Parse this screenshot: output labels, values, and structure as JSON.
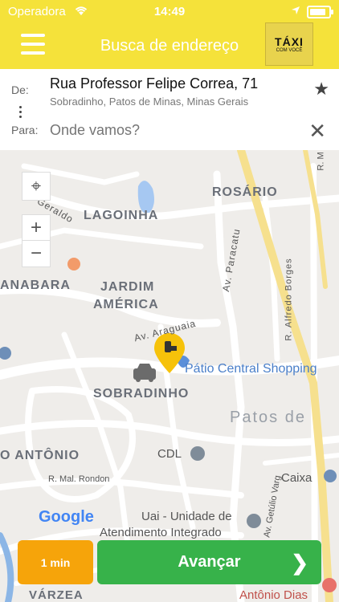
{
  "status": {
    "carrier": "Operadora",
    "time": "14:49",
    "battery_level": 0.85
  },
  "header": {
    "title": "Busca de endereço",
    "logo_text": "TÁXI",
    "logo_sub": "COM VOCÊ"
  },
  "address": {
    "from_label": "De:",
    "from_main": "Rua Professor Felipe Correa, 71",
    "from_sub": "Sobradinho, Patos de Minas, Minas Gerais",
    "to_label": "Para:",
    "to_placeholder": "Onde vamos?"
  },
  "map": {
    "labels": {
      "rosario": "ROSÁRIO",
      "lagoinha": "LAGOINHA",
      "guanabara": "ANABARA",
      "jardim": "JARDIM",
      "america": "AMÉRICA",
      "sobradinho": "SOBRADINHO",
      "patos": "Patos de",
      "antonio": "O ANTÔNIO",
      "varzea": "VÁRZEA",
      "geraldo": "Geraldo",
      "paracatu": "Av. Paracatu",
      "alfredo": "R. Alfredo Borges",
      "araguaia": "Av. Araguaia",
      "patio": "Pátio Central Shopping",
      "cdl": "CDL",
      "rondon": "R. Mal. Rondon",
      "caixa": "Caixa",
      "getulio": "Av. Getúlio Varg",
      "uai1": "Uai - Unidade de",
      "uai2": "Atendimento Integrado",
      "antoniodias": "Antônio Dias",
      "google": "Google",
      "rm": "R. M"
    }
  },
  "bottom": {
    "eta": "1 min",
    "next_label": "Avançar"
  },
  "colors": {
    "brand_yellow": "#f5e23a",
    "eta_orange": "#f6a40a",
    "go_green": "#37b24a"
  }
}
